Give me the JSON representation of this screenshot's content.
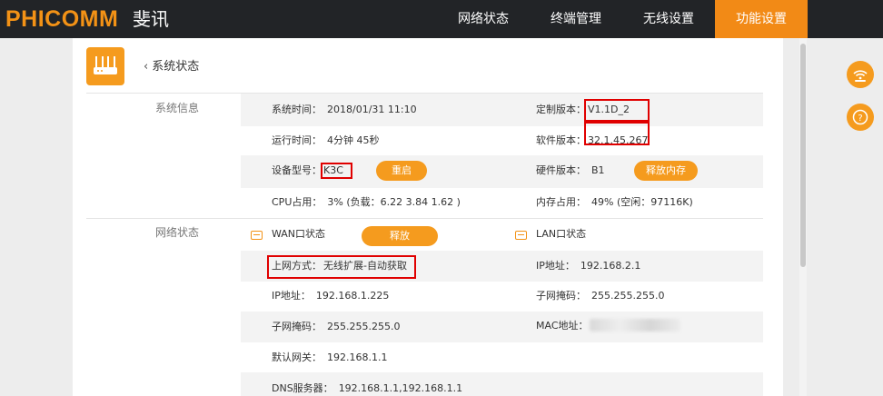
{
  "header": {
    "brand": "PHICOMM",
    "brand_cn": "斐讯",
    "nav": [
      "网络状态",
      "终端管理",
      "无线设置",
      "功能设置"
    ]
  },
  "page": {
    "back_label": "系统状态"
  },
  "system_info": {
    "section_label": "系统信息",
    "system_time": {
      "label": "系统时间：",
      "value": "2018/01/31 11:10"
    },
    "uptime": {
      "label": "运行时间：",
      "value": "4分钟 45秒"
    },
    "model": {
      "label": "设备型号：",
      "value": "K3C"
    },
    "cpu": {
      "label": "CPU占用：",
      "value": "3% (负载：6.22 3.84 1.62 )"
    },
    "custom_version": {
      "label": "定制版本：",
      "value": "V1.1D_2"
    },
    "software_version": {
      "label": "软件版本：",
      "value": "32.1.45.267"
    },
    "hardware_version": {
      "label": "硬件版本：",
      "value": "B1"
    },
    "memory": {
      "label": "内存占用：",
      "value": "49% (空闲：97116K)"
    },
    "restart_button": "重启",
    "release_memory_button": "释放内存"
  },
  "network_status": {
    "section_label": "网络状态",
    "wan_title": "WAN口状态",
    "release_button": "释放",
    "connection_type": {
      "label": "上网方式：",
      "value": "无线扩展-自动获取"
    },
    "ip": {
      "label": "IP地址：",
      "value": "192.168.1.225"
    },
    "subnet": {
      "label": "子网掩码：",
      "value": "255.255.255.0"
    },
    "gateway": {
      "label": "默认网关：",
      "value": "192.168.1.1"
    },
    "dns": {
      "label": "DNS服务器：",
      "value": "192.168.1.1,192.168.1.1"
    },
    "lan_title": "LAN口状态",
    "lan_ip": {
      "label": "IP地址：",
      "value": "192.168.2.1"
    },
    "lan_subnet": {
      "label": "子网掩码：",
      "value": "255.255.255.0"
    },
    "lan_mac": {
      "label": "MAC地址：",
      "value": ""
    }
  },
  "colors": {
    "accent": "#f59b1e",
    "header_bg": "#222427",
    "highlight_box": "#e00000"
  },
  "icons": [
    "router-icon",
    "chevron-left-icon",
    "port-icon",
    "wifi-icon",
    "help-icon"
  ]
}
